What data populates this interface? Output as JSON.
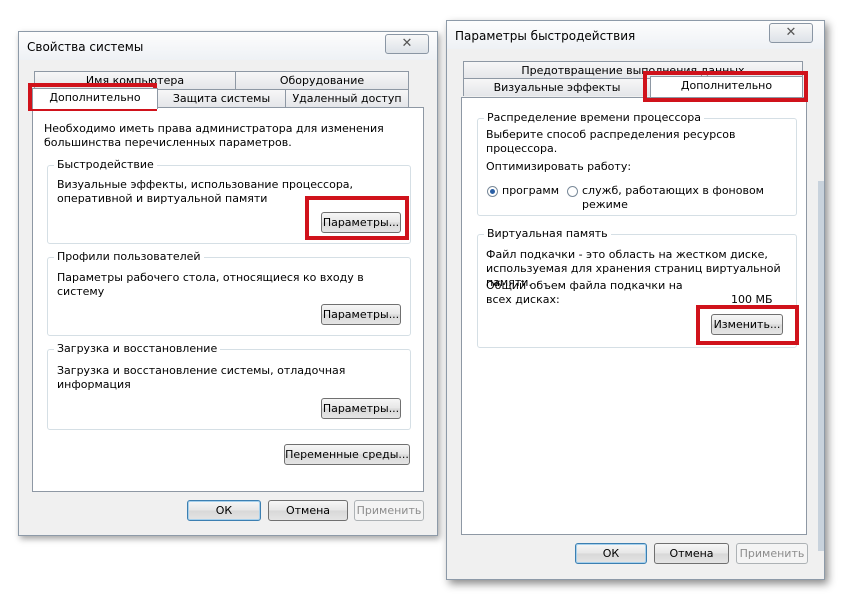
{
  "win1": {
    "title": "Свойства системы",
    "close": "✕",
    "tabs_back": [
      "Имя компьютера",
      "Оборудование"
    ],
    "tabs_front": [
      "Дополнительно",
      "Защита системы",
      "Удаленный доступ"
    ],
    "admin_note": "Необходимо иметь права администратора для изменения большинства перечисленных параметров.",
    "perf": {
      "label": "Быстродействие",
      "desc": "Визуальные эффекты, использование процессора, оперативной и виртуальной памяти",
      "button": "Параметры..."
    },
    "profiles": {
      "label": "Профили пользователей",
      "desc": "Параметры рабочего стола, относящиеся ко входу в систему",
      "button": "Параметры..."
    },
    "startup": {
      "label": "Загрузка и восстановление",
      "desc": "Загрузка и восстановление системы, отладочная информация",
      "button": "Параметры..."
    },
    "env_button": "Переменные среды...",
    "ok": "ОК",
    "cancel": "Отмена",
    "apply": "Применить"
  },
  "win2": {
    "title": "Параметры быстродействия",
    "close": "✕",
    "tab_back": "Предотвращение выполнения данных",
    "tabs_front": [
      "Визуальные эффекты",
      "Дополнительно"
    ],
    "cpu": {
      "label": "Распределение времени процессора",
      "desc": "Выберите способ распределения ресурсов процессора.",
      "optimize_label": "Оптимизировать работу:",
      "option_programs": "программ",
      "option_services": "служб, работающих в фоновом режиме",
      "selected": "программ"
    },
    "vm": {
      "label": "Виртуальная память",
      "desc": "Файл подкачки - это область на жестком диске, используемая для хранения страниц виртуальной памяти.",
      "total_label": "Общий объем файла подкачки на всех дисках:",
      "total_value": "100 МБ",
      "change_button": "Изменить..."
    },
    "ok": "ОК",
    "cancel": "Отмена",
    "apply": "Применить"
  },
  "colors": {
    "highlight": "#d0121b",
    "window_bg": "#f0f0f0",
    "panel_bg": "#ffffff"
  }
}
